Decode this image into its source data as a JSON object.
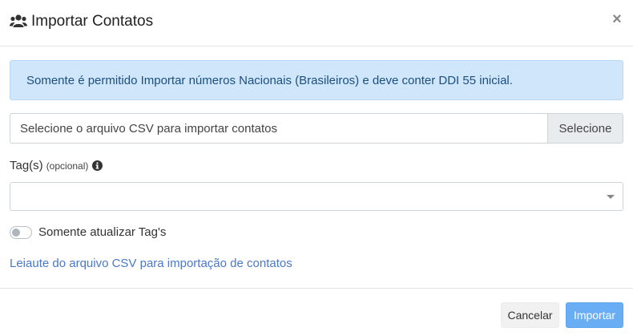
{
  "header": {
    "title": "Importar Contatos",
    "title_icon": "users-icon",
    "close_label": "×"
  },
  "alert": {
    "text": "Somente é permitido Importar números Nacionais (Brasileiros) e deve conter DDI 55 inicial."
  },
  "file_input": {
    "placeholder": "Selecione o arquivo CSV para importar contatos",
    "button_label": "Selecione"
  },
  "tags": {
    "label": "Tag(s)",
    "optional": "(opcional)",
    "info_icon": "info-circle-icon",
    "selected_value": ""
  },
  "toggle": {
    "label": "Somente atualizar Tag's",
    "checked": false
  },
  "link": {
    "text": "Leiaute do arquivo CSV para importação de contatos"
  },
  "footer": {
    "cancel_label": "Cancelar",
    "import_label": "Importar"
  },
  "colors": {
    "alert_bg": "#cfe6fb",
    "alert_text": "#1c4e7f",
    "link": "#4b78c8",
    "primary": "#69aef5"
  }
}
